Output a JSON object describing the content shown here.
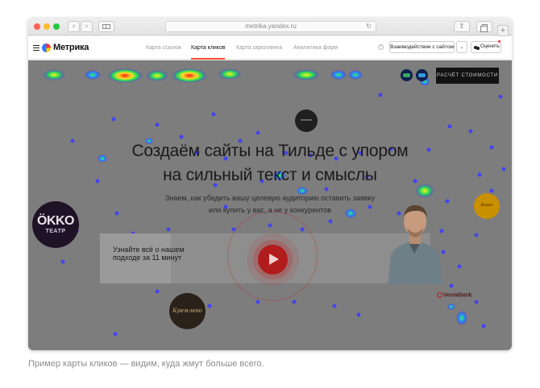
{
  "browser": {
    "url": "metrika.yandex.ru"
  },
  "metrika": {
    "title": "Метрика",
    "tabs": [
      {
        "label": "Карта ссылок",
        "active": false
      },
      {
        "label": "Карта кликов",
        "active": true
      },
      {
        "label": "Карта скроллинга",
        "active": false
      },
      {
        "label": "Аналитика форм",
        "active": false
      }
    ],
    "interaction_select": "Взаимодействие с сайтом",
    "rate_button": "Оценить",
    "accent_color": "#ff4b33"
  },
  "page": {
    "headline_line1": "Создаём сайты на Тильде с упором",
    "headline_line2": "на сильный текст и смыслы",
    "subtitle_line1": "Знаем, как убедить вашу целевую аудиторию оставить заявку",
    "subtitle_line2": "или купить у вас, а не у конкурентов",
    "okko_title": "ÖKKO",
    "okko_subtitle": "ТЕАТР",
    "promo_text": "Узнайте всё о нашем подходе за 11 минут",
    "calc_button": "РАСЧЁТ СТОИМОСТИ",
    "vesta_logo": "VestaBank",
    "cream_logo": "Кремлево",
    "gold_logo": "Bravo",
    "heatmap_colors": [
      "#2b2bff",
      "#22dd55",
      "#ffee22",
      "#ff2222"
    ]
  },
  "caption": "Пример карты кликов — видим, куда жмут больше всего."
}
